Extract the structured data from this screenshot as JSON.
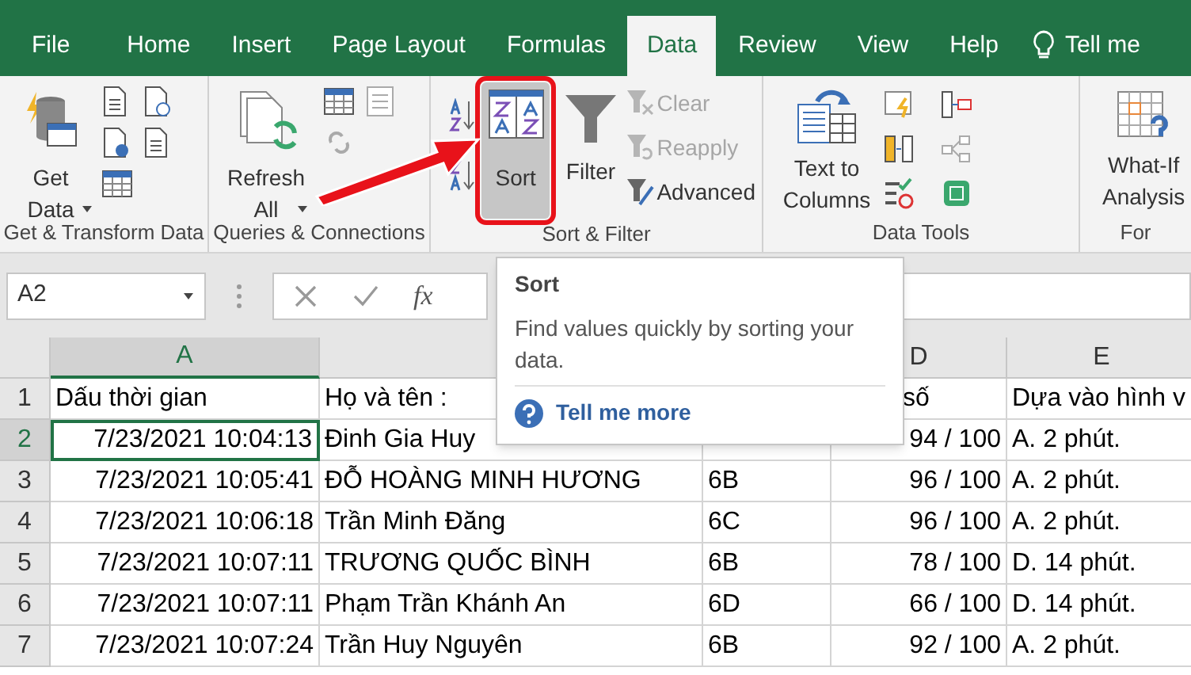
{
  "tabs": [
    {
      "label": "File",
      "selected": false
    },
    {
      "label": "Home",
      "selected": false
    },
    {
      "label": "Insert",
      "selected": false
    },
    {
      "label": "Page Layout",
      "selected": false
    },
    {
      "label": "Formulas",
      "selected": false
    },
    {
      "label": "Data",
      "selected": true
    },
    {
      "label": "Review",
      "selected": false
    },
    {
      "label": "View",
      "selected": false
    },
    {
      "label": "Help",
      "selected": false
    }
  ],
  "tell_me": "Tell me",
  "ribbon": {
    "groups": [
      {
        "label": "Get & Transform Data",
        "kind": "get",
        "large": {
          "label": "Get Data",
          "dropdown": true
        }
      },
      {
        "label": "Queries & Connections",
        "kind": "queries",
        "large": {
          "label": "Refresh All",
          "dropdown": true
        }
      },
      {
        "label": "Sort & Filter",
        "kind": "sort",
        "sort": {
          "label": "Sort",
          "highlighted": true
        },
        "filter": {
          "label": "Filter"
        },
        "small": [
          {
            "label": "Clear",
            "disabled": true
          },
          {
            "label": "Reapply",
            "disabled": true
          },
          {
            "label": "Advanced",
            "disabled": false
          }
        ]
      },
      {
        "label": "Data Tools",
        "kind": "tools",
        "large": {
          "label": "Text to Columns"
        }
      },
      {
        "label": "For",
        "kind": "forecast",
        "large": {
          "label": "What-If Analysis"
        }
      }
    ]
  },
  "name_box": "A2",
  "formula_fx": "fx",
  "columns": [
    {
      "label": "A",
      "selected": true
    },
    null,
    null,
    {
      "label": "D",
      "selected": false
    },
    {
      "label": "E",
      "selected": false
    }
  ],
  "rows": [
    {
      "number": "1",
      "selected": false,
      "cells": [
        "Dấu thời gian",
        "Họ và tên :",
        null,
        "số",
        "Dựa vào hình v"
      ]
    },
    {
      "number": "2",
      "selected": true,
      "cells": [
        "7/23/2021 10:04:13",
        "Đinh Gia Huy",
        null,
        "94 / 100",
        "A. 2 phút."
      ]
    },
    {
      "number": "3",
      "selected": false,
      "cells": [
        "7/23/2021 10:05:41",
        "ĐỖ HOÀNG MINH HƯƠNG",
        "6B",
        "96 / 100",
        "A. 2 phút."
      ]
    },
    {
      "number": "4",
      "selected": false,
      "cells": [
        "7/23/2021 10:06:18",
        "Trần Minh Đăng",
        "6C",
        "96 / 100",
        "A. 2 phút."
      ]
    },
    {
      "number": "5",
      "selected": false,
      "cells": [
        "7/23/2021 10:07:11",
        "TRƯƠNG QUỐC BÌNH",
        "6B",
        "78 / 100",
        "D. 14 phút."
      ]
    },
    {
      "number": "6",
      "selected": false,
      "cells": [
        "7/23/2021 10:07:11",
        "Phạm Trần Khánh An",
        "6D",
        "66 / 100",
        "D. 14 phút."
      ]
    },
    {
      "number": "7",
      "selected": false,
      "cells": [
        "7/23/2021 10:07:24",
        "Trần Huy Nguyên",
        "6B",
        "92 / 100",
        "A. 2 phút."
      ]
    }
  ],
  "tooltip": {
    "title": "Sort",
    "body": "Find values quickly by sorting your data.",
    "link": "Tell me more"
  }
}
